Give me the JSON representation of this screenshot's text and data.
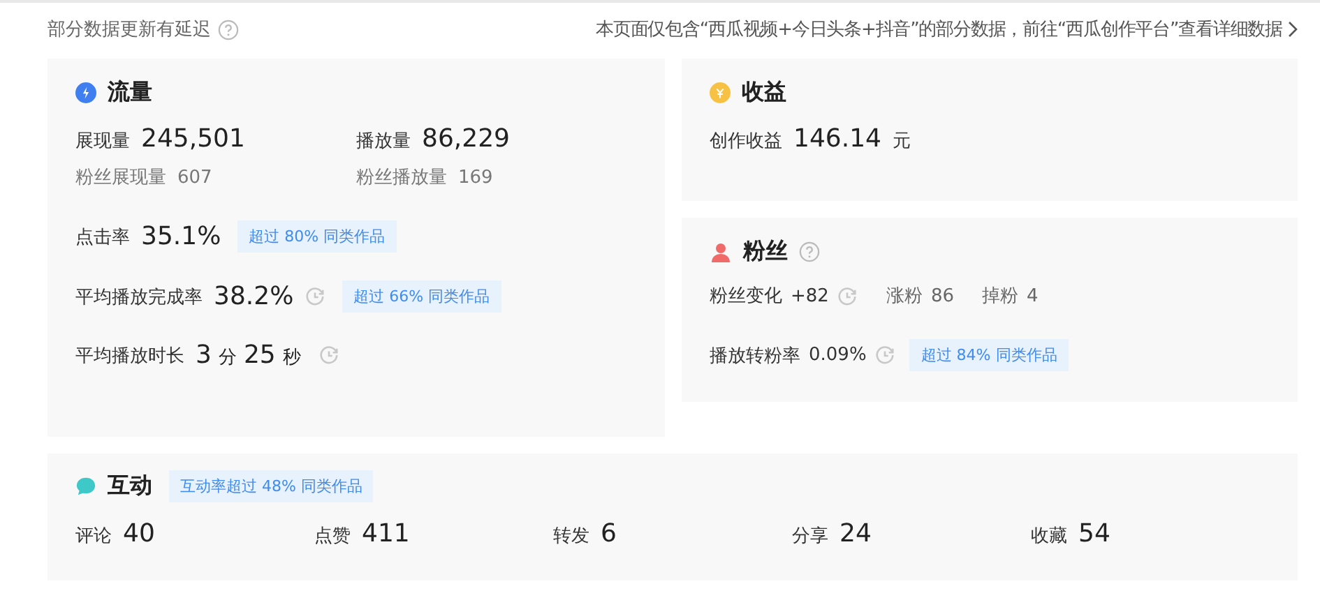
{
  "notice": {
    "text": "部分数据更新有延迟",
    "link": "本页面仅包含“西瓜视频+今日头条+抖音”的部分数据，前往“西瓜创作平台”查看详细数据"
  },
  "traffic": {
    "title": "流量",
    "primary": [
      {
        "label": "展现量",
        "value": "245,501"
      },
      {
        "label": "播放量",
        "value": "86,229"
      }
    ],
    "secondary": [
      {
        "label": "粉丝展现量",
        "value": "607"
      },
      {
        "label": "粉丝播放量",
        "value": "169"
      }
    ],
    "metrics": [
      {
        "label": "点击率",
        "parts": [
          {
            "kind": "num",
            "text": "35.1%"
          }
        ],
        "clock": false,
        "badge": "超过 80% 同类作品"
      },
      {
        "label": "平均播放完成率",
        "parts": [
          {
            "kind": "num",
            "text": "38.2%"
          }
        ],
        "clock": true,
        "badge": "超过 66% 同类作品"
      },
      {
        "label": "平均播放时长",
        "parts": [
          {
            "kind": "num",
            "text": "3"
          },
          {
            "kind": "unit",
            "text": "分"
          },
          {
            "kind": "num",
            "text": "25"
          },
          {
            "kind": "unit",
            "text": "秒"
          }
        ],
        "clock": true
      }
    ]
  },
  "income": {
    "title": "收益",
    "label": "创作收益",
    "value": "146.14",
    "unit": "元"
  },
  "fans": {
    "title": "粉丝",
    "change_label": "粉丝变化",
    "change_value": "+82",
    "gain_label": "涨粉",
    "gain_value": "86",
    "loss_label": "掉粉",
    "loss_value": "4",
    "rate_label": "播放转粉率",
    "rate_value": "0.09%",
    "rate_badge": "超过 84% 同类作品"
  },
  "interaction": {
    "title": "互动",
    "badge": "互动率超过 48% 同类作品",
    "stats": [
      {
        "label": "评论",
        "value": "40"
      },
      {
        "label": "点赞",
        "value": "411"
      },
      {
        "label": "转发",
        "value": "6"
      },
      {
        "label": "分享",
        "value": "24"
      },
      {
        "label": "收藏",
        "value": "54"
      }
    ]
  }
}
